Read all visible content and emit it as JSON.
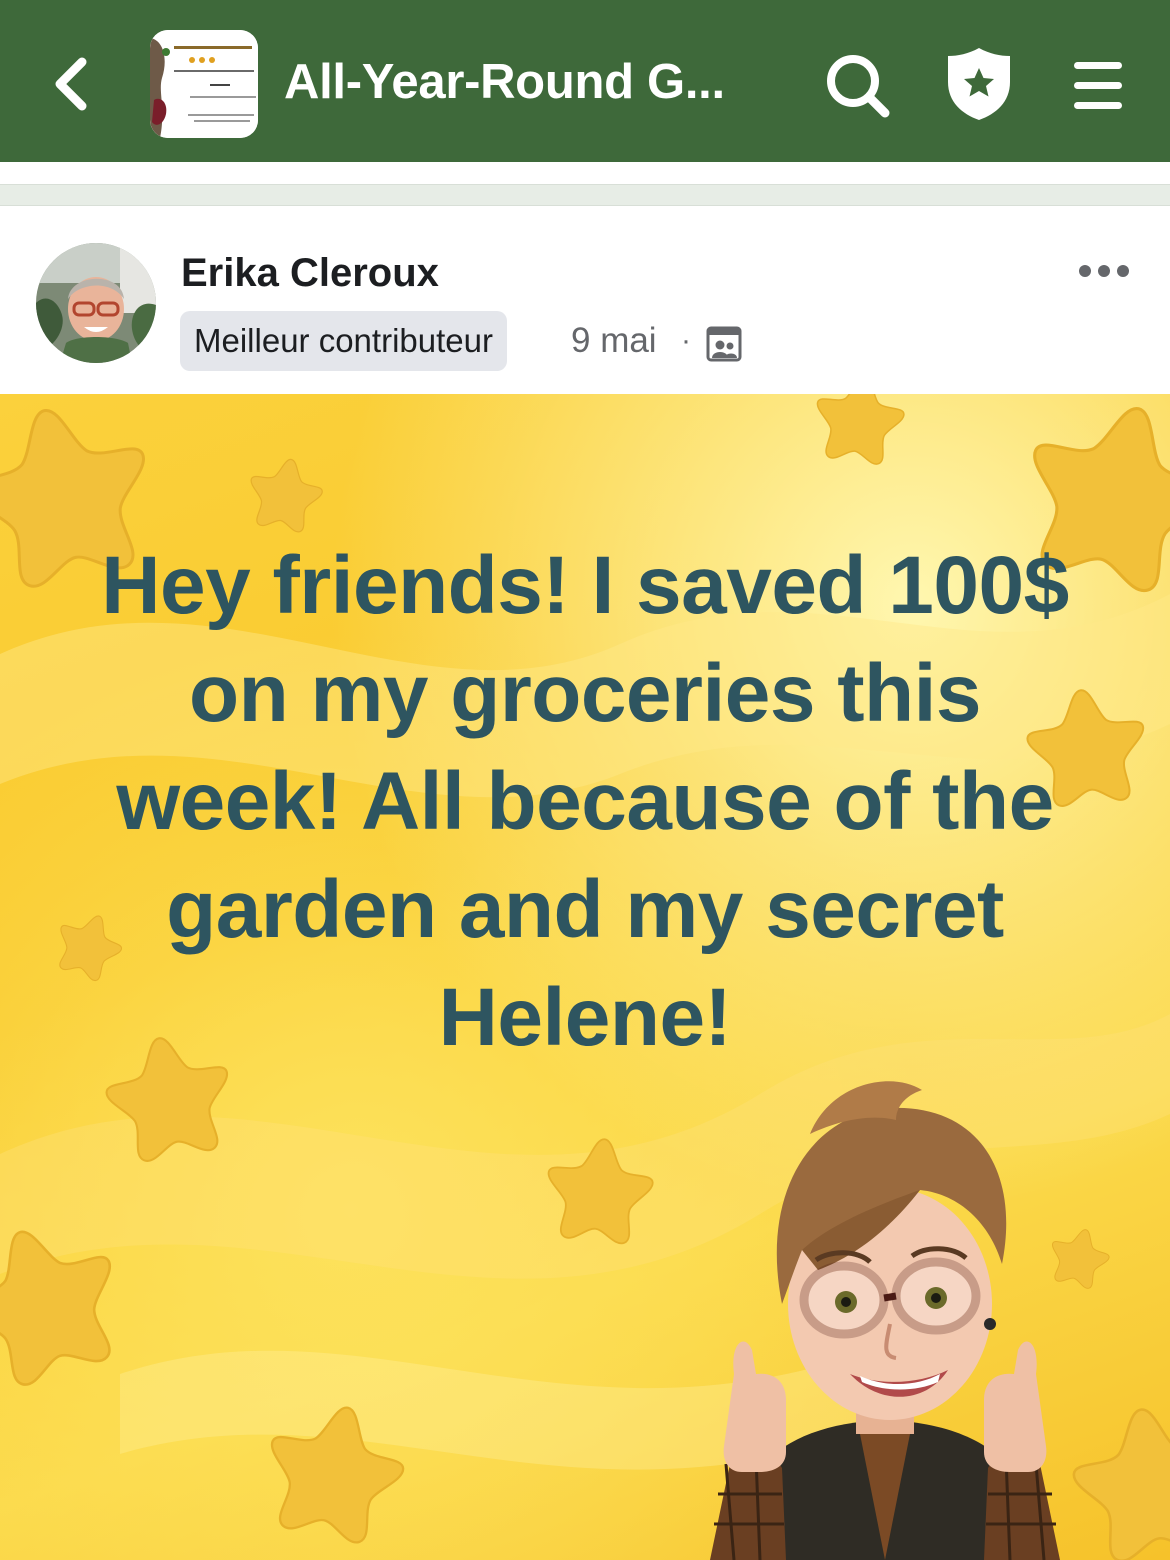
{
  "app_bar": {
    "group_title": "All-Year-Round G...",
    "background_color": "#3e693a",
    "icons": [
      "chevron-left-icon",
      "search-icon",
      "shield-star-icon",
      "hamburger-menu-icon"
    ]
  },
  "post": {
    "author_name": "Erika Cleroux",
    "badge": "Meilleur contributeur",
    "date": "9 mai",
    "separator": "·",
    "audience_icon": "group-members-icon",
    "more_icon": "more-horizontal-icon",
    "text": "Hey friends! I saved 100$ on my groceries this week! All because of the garden and my secret Helene!",
    "text_color": "#2e5560",
    "background": "yellow-stars"
  }
}
